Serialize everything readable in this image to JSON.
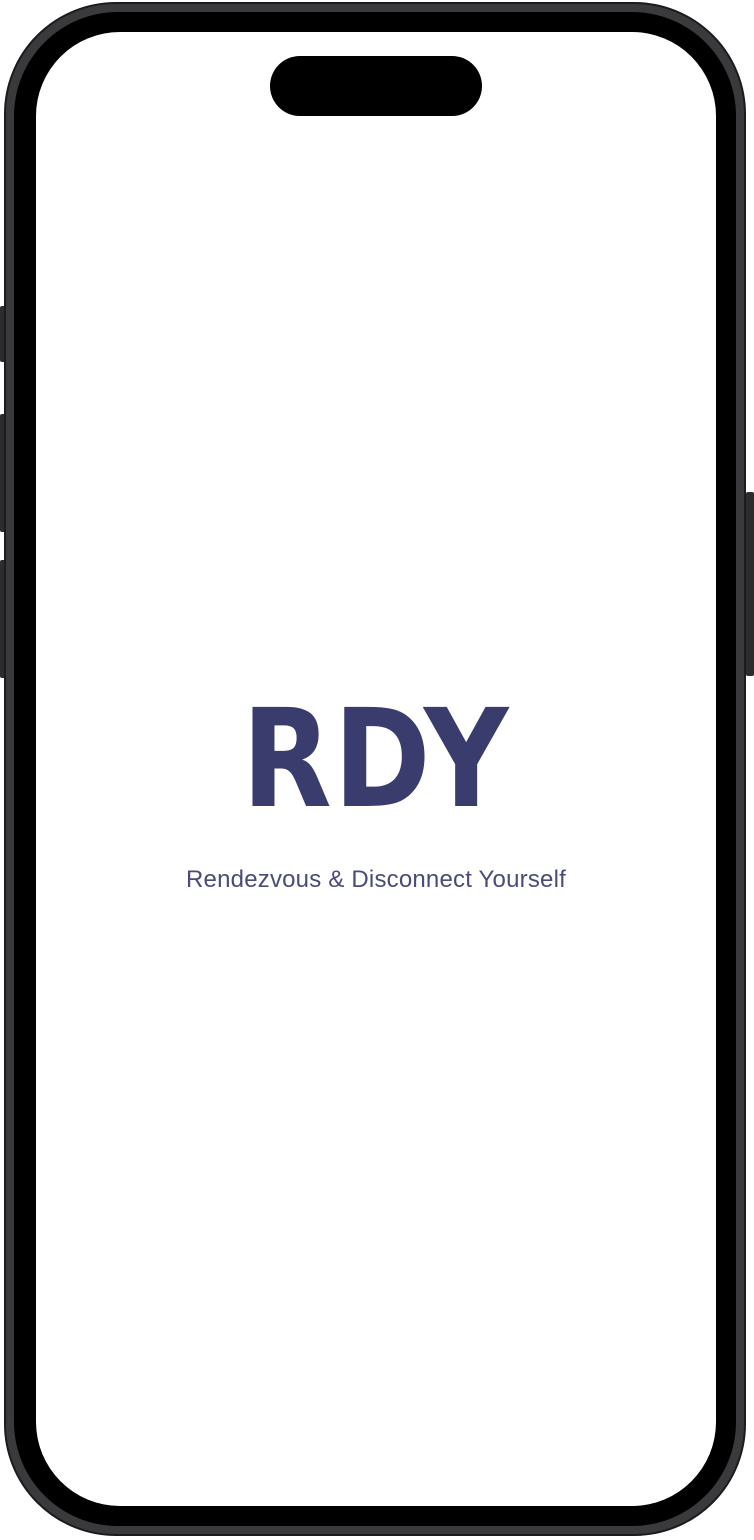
{
  "app": {
    "logo_text": "RDY",
    "tagline": "Rendezvous & Disconnect Yourself"
  },
  "colors": {
    "brand": "#3b3c6e",
    "background": "#ffffff",
    "device_frame": "#3a3a3c"
  }
}
